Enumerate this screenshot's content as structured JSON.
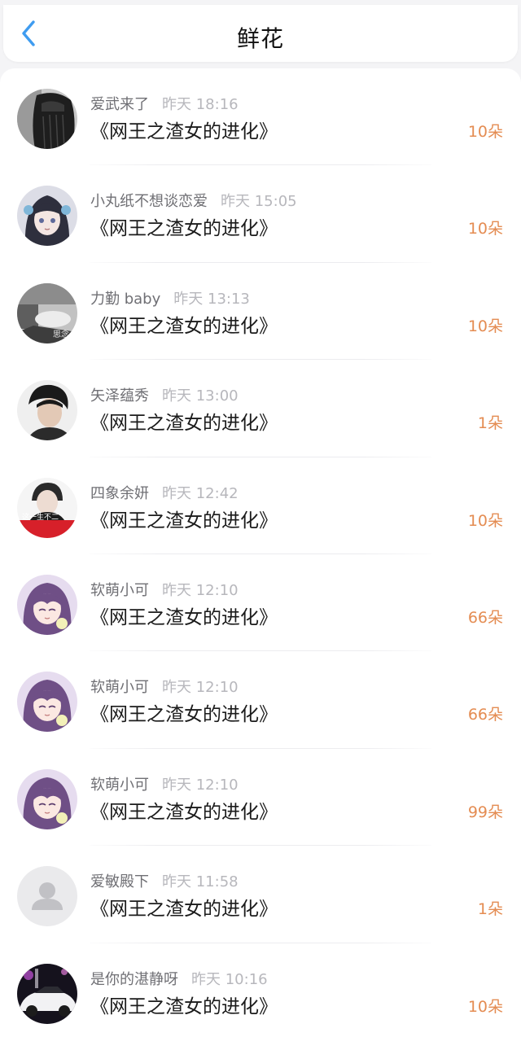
{
  "header": {
    "title": "鲜花",
    "back_icon": "chevron-left-icon",
    "accent_color": "#3f9cf0"
  },
  "flowers": [
    {
      "user": "爱武来了",
      "time": "昨天 18:16",
      "book": "《网王之渣女的进化》",
      "amount": "10朵",
      "avatar": "dark-hair-photo"
    },
    {
      "user": "小丸纸不想谈恋爱",
      "time": "昨天 15:05",
      "book": "《网王之渣女的进化》",
      "amount": "10朵",
      "avatar": "anime-girl"
    },
    {
      "user": "力勤 baby",
      "time": "昨天 13:13",
      "book": "《网王之渣女的进化》",
      "amount": "10朵",
      "avatar": "grey-photo"
    },
    {
      "user": "矢泽蕴秀",
      "time": "昨天 13:00",
      "book": "《网王之渣女的进化》",
      "amount": "1朵",
      "avatar": "boy-portrait"
    },
    {
      "user": "四象余妍",
      "time": "昨天 12:42",
      "book": "《网王之渣女的进化》",
      "amount": "10朵",
      "avatar": "red-text-photo"
    },
    {
      "user": "软萌小可",
      "time": "昨天 12:10",
      "book": "《网王之渣女的进化》",
      "amount": "66朵",
      "avatar": "anime-purple-hair"
    },
    {
      "user": "软萌小可",
      "time": "昨天 12:10",
      "book": "《网王之渣女的进化》",
      "amount": "66朵",
      "avatar": "anime-purple-hair"
    },
    {
      "user": "软萌小可",
      "time": "昨天 12:10",
      "book": "《网王之渣女的进化》",
      "amount": "99朵",
      "avatar": "anime-purple-hair"
    },
    {
      "user": "爱敏殿下",
      "time": "昨天 11:58",
      "book": "《网王之渣女的进化》",
      "amount": "1朵",
      "avatar": "default-user-icon"
    },
    {
      "user": "是你的湛静呀",
      "time": "昨天 10:16",
      "book": "《网王之渣女的进化》",
      "amount": "10朵",
      "avatar": "white-car"
    }
  ]
}
